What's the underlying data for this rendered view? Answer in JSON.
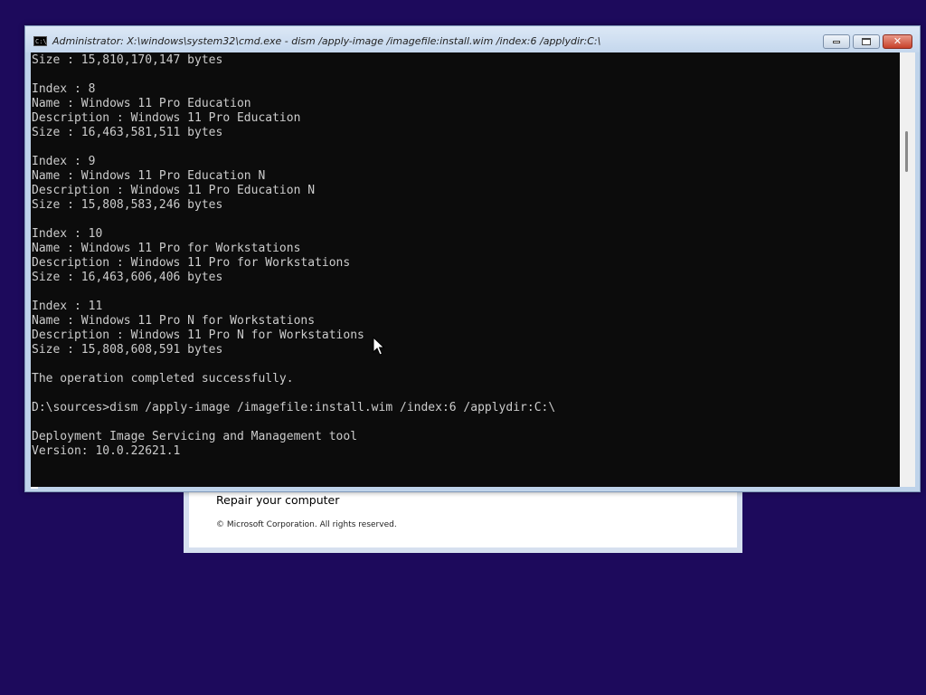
{
  "setup": {
    "repair_label": "Repair your computer",
    "copyright": "© Microsoft Corporation. All rights reserved."
  },
  "cmd": {
    "title": "Administrator: X:\\windows\\system32\\cmd.exe - dism  /apply-image /imagefile:install.wim /index:6 /applydir:C:\\",
    "icon_text": "C:\\.",
    "buttons": {
      "minimize": "minimize-icon",
      "maximize": "maximize-icon",
      "close": "✕"
    },
    "lines": [
      "Size : 15,810,170,147 bytes",
      "",
      "Index : 8",
      "Name : Windows 11 Pro Education",
      "Description : Windows 11 Pro Education",
      "Size : 16,463,581,511 bytes",
      "",
      "Index : 9",
      "Name : Windows 11 Pro Education N",
      "Description : Windows 11 Pro Education N",
      "Size : 15,808,583,246 bytes",
      "",
      "Index : 10",
      "Name : Windows 11 Pro for Workstations",
      "Description : Windows 11 Pro for Workstations",
      "Size : 16,463,606,406 bytes",
      "",
      "Index : 11",
      "Name : Windows 11 Pro N for Workstations",
      "Description : Windows 11 Pro N for Workstations",
      "Size : 15,808,608,591 bytes",
      "",
      "The operation completed successfully.",
      "",
      "D:\\sources>dism /apply-image /imagefile:install.wim /index:6 /applydir:C:\\",
      "",
      "Deployment Image Servicing and Management tool",
      "Version: 10.0.22621.1"
    ]
  },
  "colors": {
    "desktop_bg": "#1d0a5c",
    "console_bg": "#0c0c0c",
    "console_text": "#cccccc",
    "window_frame": "#bfd3ea",
    "close_button": "#c7412a"
  }
}
